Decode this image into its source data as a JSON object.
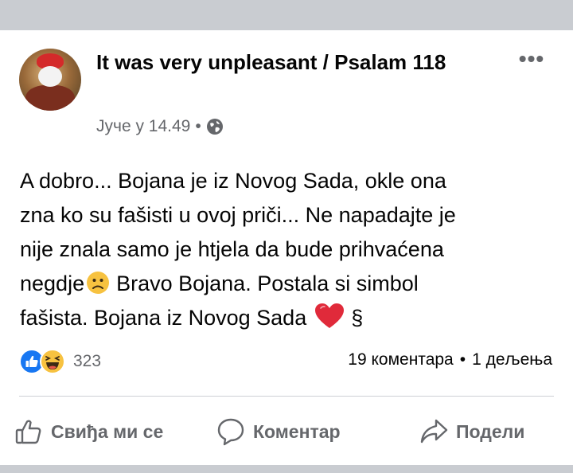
{
  "post": {
    "author": "It was very unpleasant / Psalam 118",
    "timestamp": "Јуче у 14.49",
    "separator": "•",
    "audience_icon": "globe-icon",
    "more_icon": "more-options-icon",
    "body": {
      "line1": "A dobro... Bojana je iz Novog Sada, okle ona",
      "line2": "zna ko su fašisti u ovoj priči... Ne napadajte je",
      "line3": "nije znala samo je htjela da bude prihvaćena",
      "line4_before_emoji": "negdje",
      "line4_after_emoji": "Bravo Bojana. Postala si simbol",
      "line5_before_emoji": "fašista. Bojana iz Novog Sada",
      "line5_after_emoji": "§",
      "emojis": [
        "frowning-face",
        "red-heart"
      ]
    },
    "reactions": {
      "icons": [
        "like-reaction-icon",
        "haha-reaction-icon"
      ],
      "count": "323"
    },
    "stats": {
      "comments": "19 коментара",
      "separator": "•",
      "shares": "1 дељења"
    },
    "actions": {
      "like": "Свиђа ми се",
      "comment": "Коментар",
      "share": "Подели"
    }
  },
  "colors": {
    "band": "#c9ccd1",
    "secondary_text": "#65676b",
    "like_blue": "#1877f2",
    "haha_yellow": "#f7c240",
    "heart_red": "#e02a3a"
  }
}
